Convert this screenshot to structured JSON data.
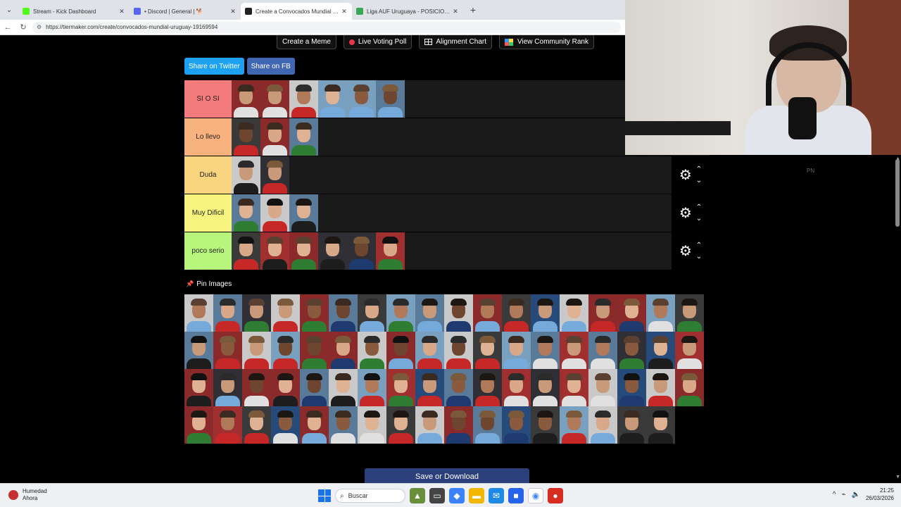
{
  "browser": {
    "tabs": [
      {
        "label": "Stream - Kick Dashboard",
        "color": "#53fc18",
        "active": false
      },
      {
        "label": "• Discord | General | 🐕",
        "color": "#5865f2",
        "active": false
      },
      {
        "label": "Create a Convocados Mundial Uru",
        "color": "#222222",
        "active": true
      },
      {
        "label": "Liga AUF Uruguaya - POSICIONES",
        "color": "#3aa757",
        "active": false
      }
    ],
    "new_tab": "+",
    "url": "https://tiermaker.com/create/convocados-mundial-uruguay-19169594"
  },
  "page": {
    "top_buttons": [
      {
        "label": "Create a Meme",
        "icon": "none"
      },
      {
        "label": "Live Voting Poll",
        "icon": "red-dot-icon"
      },
      {
        "label": "Alignment Chart",
        "icon": "grid-icon"
      },
      {
        "label": "View Community Rank",
        "icon": "rank-icon"
      }
    ],
    "share_twitter": "Share on Twitter",
    "share_fb": "Share on FB",
    "tiers": [
      {
        "label": "SI O SI",
        "color": "#f47b7b",
        "count": 6,
        "controls": false
      },
      {
        "label": "Lo llevo",
        "color": "#f8b27d",
        "count": 3,
        "controls": false
      },
      {
        "label": "Duda",
        "color": "#f9d57f",
        "count": 2,
        "controls": true
      },
      {
        "label": "Muy Dificil",
        "color": "#f8f57e",
        "count": 3,
        "controls": true
      },
      {
        "label": "poco serio",
        "color": "#b7f57c",
        "count": 6,
        "controls": true
      }
    ],
    "pin_label": "Pin Images",
    "pool_count": 71,
    "save_button": "Save or Download",
    "overlay_text": "PN"
  },
  "taskbar": {
    "weather_title": "Humedad",
    "weather_sub": "Ahora",
    "search": "Buscar",
    "time": "21:25",
    "date": "26/03/2026"
  }
}
